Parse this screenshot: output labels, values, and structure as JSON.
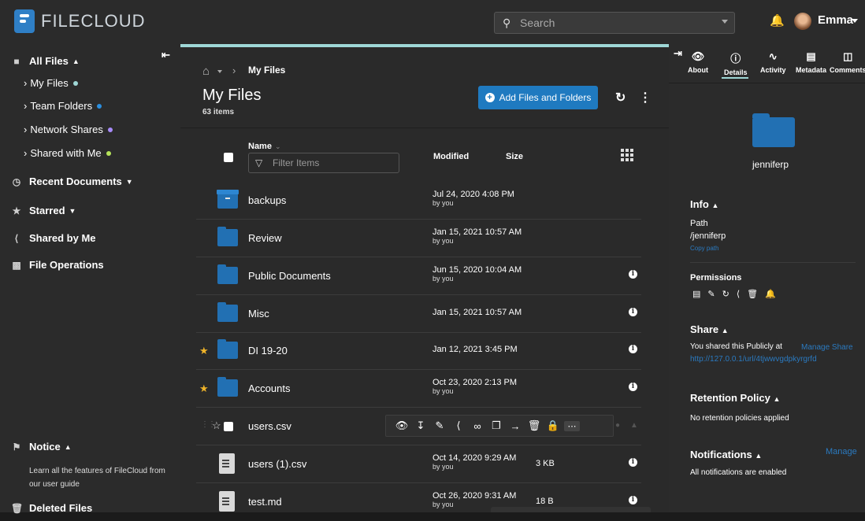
{
  "header": {
    "logo_text": "FILECLOUD",
    "search_placeholder": "Search",
    "user_name": "Emma"
  },
  "sidebar": {
    "all_files": "All Files",
    "my_files": "My Files",
    "team_folders": "Team Folders",
    "network_shares": "Network Shares",
    "shared_with_me": "Shared with Me",
    "recent_documents": "Recent Documents",
    "starred": "Starred",
    "shared_by_me": "Shared by Me",
    "file_operations": "File Operations",
    "notice": "Notice",
    "notice_text": "Learn all the features of FileCloud from our user guide",
    "deleted_files": "Deleted Files",
    "dot_colors": {
      "my_files": "#9fd7d6",
      "team_folders": "#2b8fe0",
      "network_shares": "#a78bfa",
      "shared_with_me": "#b5e35a"
    }
  },
  "main": {
    "breadcrumb_current": "My Files",
    "title": "My Files",
    "item_count": "63 items",
    "add_button": "Add Files and Folders",
    "col_name": "Name",
    "filter_placeholder": "Filter Items",
    "col_modified": "Modified",
    "col_size": "Size",
    "rows": [
      {
        "name": "backups",
        "modified": "Jul 24, 2020 4:08 PM",
        "by": "by you",
        "size": "",
        "icon": "archive-icon",
        "starred": false
      },
      {
        "name": "Review",
        "modified": "Jan 15, 2021 10:57 AM",
        "by": "by you",
        "size": "",
        "icon": "folder-icon",
        "starred": false
      },
      {
        "name": "Public Documents",
        "modified": "Jun 15, 2020 10:04 AM",
        "by": "by you",
        "size": "",
        "icon": "folder-icon",
        "starred": false
      },
      {
        "name": "Misc",
        "modified": "Jan 15, 2021 10:57 AM",
        "by": "",
        "size": "",
        "icon": "folder-icon",
        "starred": false
      },
      {
        "name": "DI 19-20",
        "modified": "Jan 12, 2021 3:45 PM",
        "by": "",
        "size": "",
        "icon": "folder-icon",
        "starred": true
      },
      {
        "name": "Accounts",
        "modified": "Oct 23, 2020 2:13 PM",
        "by": "by you",
        "size": "",
        "icon": "folder-icon",
        "starred": true
      },
      {
        "name": "users.csv",
        "modified": "",
        "by": "",
        "size": "",
        "icon": "",
        "starred": false
      },
      {
        "name": "users (1).csv",
        "modified": "Oct 14, 2020 9:29 AM",
        "by": "by you",
        "size": "3 KB",
        "icon": "document-icon",
        "starred": false
      },
      {
        "name": "test.md",
        "modified": "Oct 26, 2020 9:31 AM",
        "by": "by you",
        "size": "18 B",
        "icon": "document-icon",
        "starred": false
      }
    ]
  },
  "details": {
    "tabs": [
      "About",
      "Details",
      "Activity",
      "Metadata",
      "Comments"
    ],
    "active_tab": "Details",
    "owner": "jenniferp",
    "info_title": "Info",
    "path_label": "Path",
    "path_value": "/jenniferp",
    "copy_path": "Copy path",
    "permissions_label": "Permissions",
    "share_title": "Share",
    "shared_text": "You shared this Publicly at",
    "manage_share": "Manage Share",
    "share_url": "http://127.0.0.1/url/4tjwwvgdpkyrgrfd",
    "retention_title": "Retention Policy",
    "retention_text": "No retention policies applied",
    "notifications_title": "Notifications",
    "manage": "Manage",
    "notifications_text": "All notifications are enabled"
  }
}
